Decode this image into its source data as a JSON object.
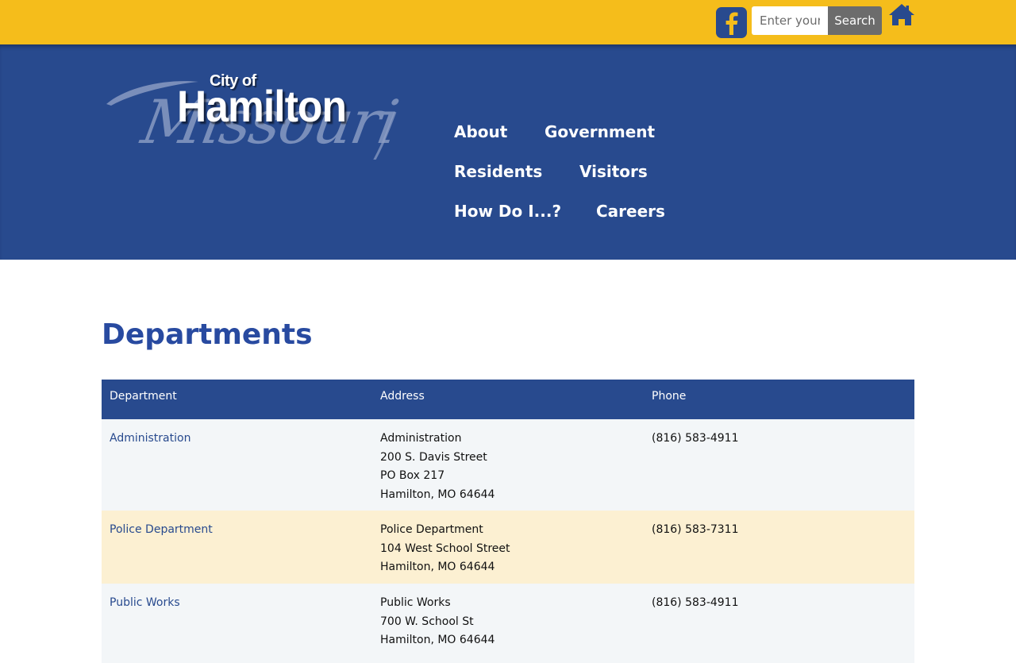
{
  "topbar": {
    "facebook_icon": "facebook-icon",
    "search": {
      "placeholder": "Enter your",
      "button_label": "Search"
    },
    "home_icon": "home-icon",
    "colors": {
      "background": "#f5bd1b",
      "brand_blue": "#284a8e",
      "search_button": "#6c6c6c"
    }
  },
  "header": {
    "logo": {
      "line1": "City of",
      "line2": "Hamilton",
      "script": "Missouri"
    },
    "nav": [
      {
        "label": "About"
      },
      {
        "label": "Government"
      },
      {
        "label": "Residents"
      },
      {
        "label": "Visitors"
      },
      {
        "label": "How Do I...?"
      },
      {
        "label": "Careers"
      }
    ]
  },
  "main": {
    "title": "Departments",
    "table": {
      "headers": [
        "Department",
        "Address",
        "Phone"
      ],
      "rows": [
        {
          "department": "Administration",
          "address": [
            "Administration",
            "200 S. Davis Street",
            "PO Box 217",
            "Hamilton, MO 64644"
          ],
          "phone": "(816) 583-4911"
        },
        {
          "department": "Police Department",
          "address": [
            "Police Department",
            "104 West School Street",
            "Hamilton, MO 64644"
          ],
          "phone": "(816) 583-7311"
        },
        {
          "department": "Public Works",
          "address": [
            "Public Works",
            "700 W. School St",
            "Hamilton, MO 64644"
          ],
          "phone": "(816) 583-4911"
        }
      ]
    }
  }
}
